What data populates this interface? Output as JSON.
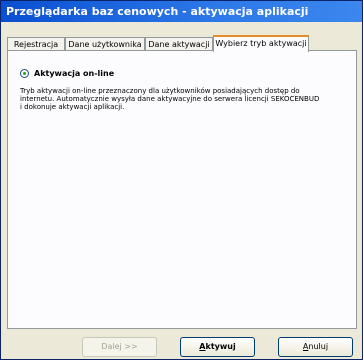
{
  "window": {
    "title": "Przeglądarka baz cenowych - aktywacja aplikacji"
  },
  "tabs": [
    {
      "label": "Rejestracja"
    },
    {
      "label": "Dane użytkownika"
    },
    {
      "label": "Dane aktywacji"
    },
    {
      "label": "Wybierz tryb aktywacji"
    }
  ],
  "panel": {
    "option_label": "Aktywacja on-line",
    "description_line1": "Tryb aktywacji on-line przeznaczony dla użytkowników posiadających dostęp do",
    "description_line2": "internetu. Automatycznie wysyła dane aktywacyjne do serwera licencji SEKOCENBUD",
    "description_line3": "i dokonuje aktywacji aplikacji."
  },
  "buttons": {
    "next_label": "Dalej >>",
    "activate_label": "Aktywuj",
    "cancel_label": "Anuluj"
  }
}
